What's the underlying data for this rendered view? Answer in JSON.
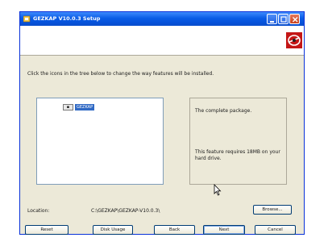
{
  "window": {
    "title": "GEZKAP V10.0.3 Setup"
  },
  "instruction": "Click the icons in the tree below to change the way features will be installed.",
  "tree": {
    "node_label": "GEZKAP"
  },
  "description": {
    "main": "The complete package.",
    "size": "This feature requires 18MB on your hard drive."
  },
  "location": {
    "label": "Location:",
    "value": "C:\\GEZKAP\\GEZKAP-V10.0.3\\"
  },
  "buttons": {
    "browse": "Browse...",
    "reset": "Reset",
    "disk_usage": "Disk Usage",
    "back": "Back",
    "next": "Next",
    "cancel": "Cancel"
  },
  "colors": {
    "titlebar": "#0a5ce6",
    "logo": "#c41616",
    "selection": "#316ac5"
  }
}
